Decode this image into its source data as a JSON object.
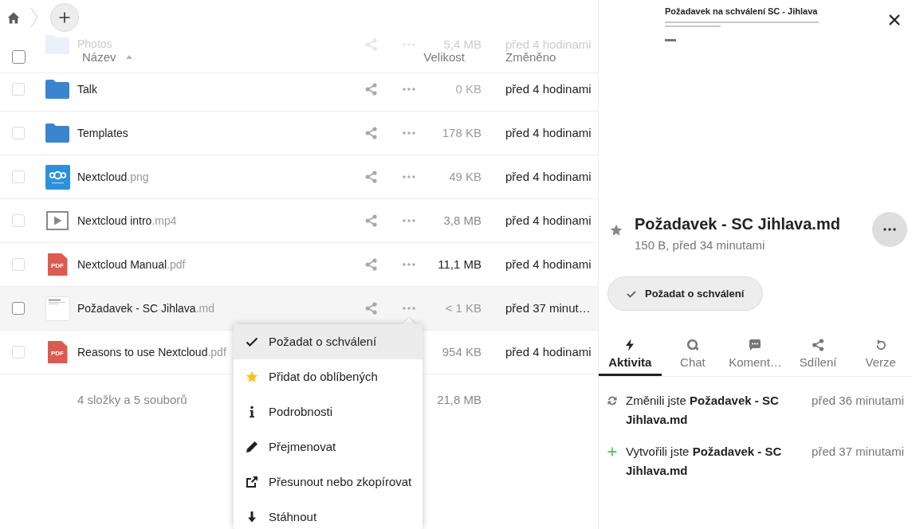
{
  "file_list": {
    "select_all": {
      "checked": false
    },
    "columns": [
      {
        "label": "Název",
        "sorted": true
      },
      {
        "label": "Velikost",
        "sorted": false
      },
      {
        "label": "Změněno",
        "sorted": false
      }
    ],
    "rows_behind_header": [
      {
        "kind": "folder",
        "name": "Photos",
        "size": "5,4 MB",
        "modified": "před 4 hodinami"
      }
    ],
    "rows": [
      {
        "kind": "folder",
        "name": "Talk",
        "size": {
          "text": "0 KB",
          "color": "#aaaaaa"
        },
        "modified": "před 4 hodinami",
        "checked": false,
        "highlighted": false
      },
      {
        "kind": "folder",
        "name": "Templates",
        "size": {
          "text": "178 KB",
          "color": "#999999"
        },
        "modified": "před 4 hodinami",
        "checked": false,
        "highlighted": false
      },
      {
        "kind": "image",
        "name": "Nextcloud.png",
        "size": {
          "text": "49 KB",
          "color": "#999999"
        },
        "modified": "před 4 hodinami",
        "checked": false,
        "highlighted": false
      },
      {
        "kind": "video",
        "name": "Nextcloud intro.mp4",
        "size": {
          "text": "3,8 MB",
          "color": "#8a8a8a"
        },
        "modified": "před 4 hodinami",
        "checked": false,
        "highlighted": false
      },
      {
        "kind": "pdf",
        "icon_label": "PDF",
        "name": "Nextcloud Manual.pdf",
        "size": {
          "text": "11,1 MB",
          "color": "#222222"
        },
        "modified": "před 4 hodinami",
        "checked": false,
        "highlighted": false
      },
      {
        "kind": "document",
        "name": "Požadavek - SC Jihlava.md",
        "size": {
          "text": "< 1 KB",
          "color": "#999999"
        },
        "modified": "před 37 minut…",
        "checked": false,
        "highlighted": true
      },
      {
        "kind": "pdf",
        "icon_label": "PDF",
        "name": "Reasons to use Nextcloud.pdf",
        "size": {
          "text": "954 KB",
          "color": "#8f8f8f"
        },
        "modified": "před 4 hodinami",
        "checked": false,
        "highlighted": false
      }
    ],
    "summary": {
      "counts": "4 složky a 5 souborů",
      "total_size": "21,8 MB"
    }
  },
  "context_menu": {
    "items": [
      {
        "label": "Požadat o schválení",
        "selected": true
      },
      {
        "label": "Přidat do oblíbených",
        "selected": false
      },
      {
        "label": "Podrobnosti",
        "selected": false
      },
      {
        "label": "Přejmenovat",
        "selected": false
      },
      {
        "label": "Přesunout nebo zkopírovat",
        "selected": false
      },
      {
        "label": "Stáhnout",
        "selected": false
      }
    ]
  },
  "details": {
    "preview": {
      "title": "Požadavek na schválení SC - Jihlava"
    },
    "favorite": false,
    "file_name": "Požadavek - SC Jihlava.md",
    "meta": "150 B, před 34 minutami",
    "action_button": {
      "label": "Požadat o schválení"
    },
    "tabs": [
      {
        "label": "Aktivita",
        "selected": true
      },
      {
        "label": "Chat",
        "selected": false
      },
      {
        "label": "Koment…",
        "selected": false
      },
      {
        "label": "Sdílení",
        "selected": false
      },
      {
        "label": "Verze",
        "selected": false
      }
    ],
    "activities": [
      {
        "kind": "changed",
        "text": "Změnili jste **Požadavek - SC Jihlava.md**",
        "time": "před 36 minutami"
      },
      {
        "kind": "created",
        "text": "Vytvořili jste **Požadavek - SC Jihlava.md**",
        "time": "před 37 minutami"
      }
    ]
  }
}
